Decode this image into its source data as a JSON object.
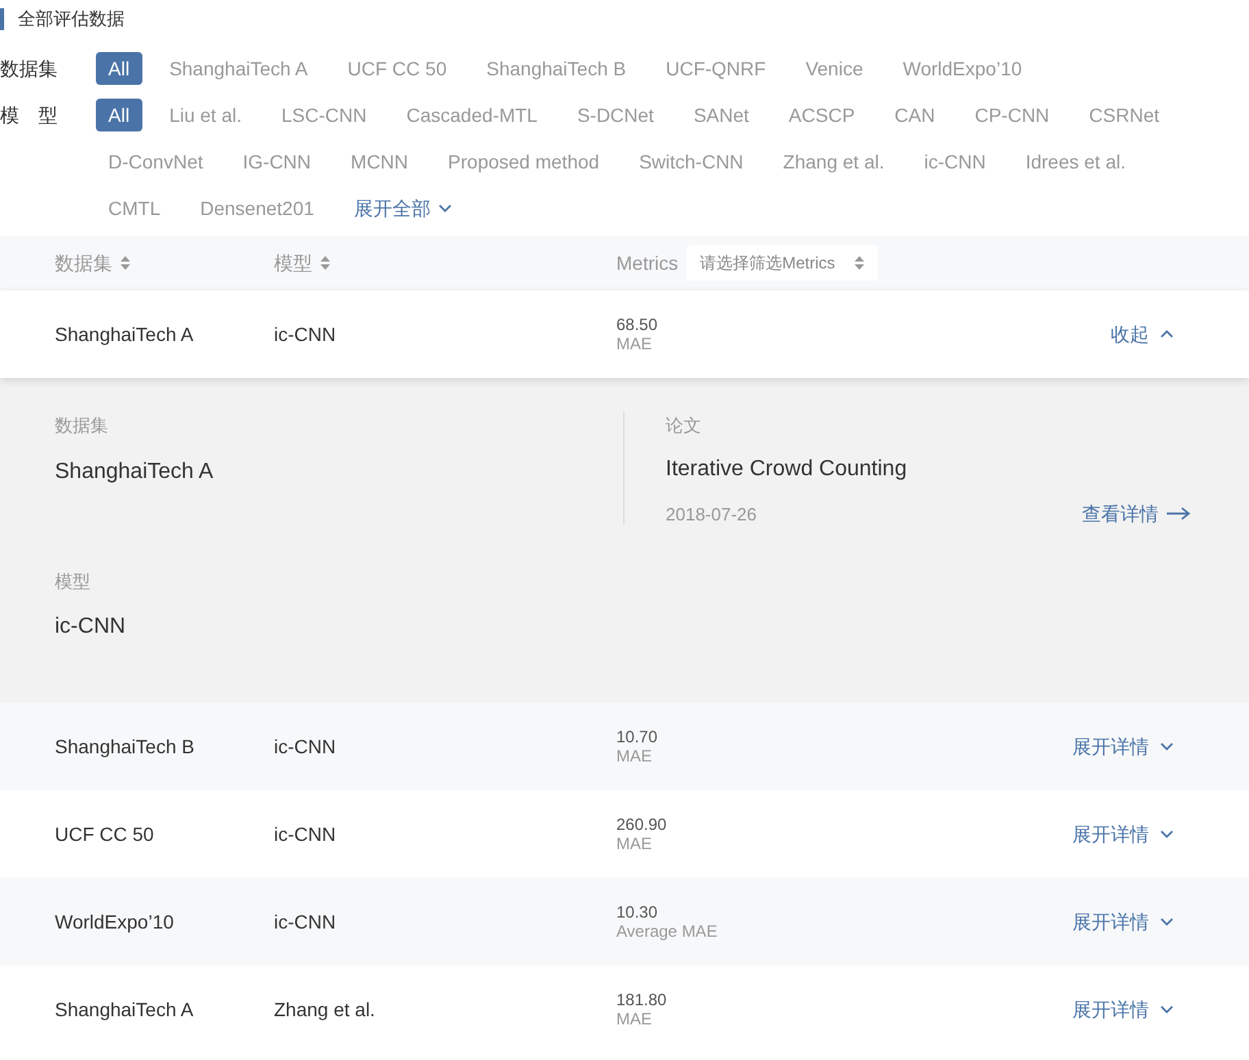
{
  "section_title": "全部评估数据",
  "filters": [
    {
      "label": "数据集",
      "options": [
        {
          "label": "All",
          "selected": true
        },
        {
          "label": "ShanghaiTech A",
          "selected": false
        },
        {
          "label": "UCF CC 50",
          "selected": false
        },
        {
          "label": "ShanghaiTech B",
          "selected": false
        },
        {
          "label": "UCF-QNRF",
          "selected": false
        },
        {
          "label": "Venice",
          "selected": false
        },
        {
          "label": "WorldExpo’10",
          "selected": false
        }
      ]
    },
    {
      "label": "模　型",
      "options": [
        {
          "label": "All",
          "selected": true
        },
        {
          "label": "Liu et al.",
          "selected": false
        },
        {
          "label": "LSC-CNN",
          "selected": false
        },
        {
          "label": "Cascaded-MTL",
          "selected": false
        },
        {
          "label": "S-DCNet",
          "selected": false
        },
        {
          "label": "SANet",
          "selected": false
        },
        {
          "label": "ACSCP",
          "selected": false
        },
        {
          "label": "CAN",
          "selected": false
        },
        {
          "label": "CP-CNN",
          "selected": false
        },
        {
          "label": "CSRNet",
          "selected": false
        },
        {
          "label": "D-ConvNet",
          "selected": false
        },
        {
          "label": "IG-CNN",
          "selected": false
        },
        {
          "label": "MCNN",
          "selected": false
        },
        {
          "label": "Proposed method",
          "selected": false
        },
        {
          "label": "Switch-CNN",
          "selected": false
        },
        {
          "label": "Zhang et al.",
          "selected": false
        },
        {
          "label": "ic-CNN",
          "selected": false
        },
        {
          "label": "Idrees et al.",
          "selected": false
        },
        {
          "label": "CMTL",
          "selected": false
        },
        {
          "label": "Densenet201",
          "selected": false
        }
      ],
      "more_link": "展开全部"
    }
  ],
  "table": {
    "columns": [
      {
        "label": "数据集",
        "kind": "sortable"
      },
      {
        "label": "模型",
        "kind": "sortable"
      },
      {
        "label": "Metrics",
        "kind": "select",
        "placeholder": "请选择筛选Metrics"
      }
    ],
    "rows": [
      {
        "dataset": "ShanghaiTech A",
        "model": "ic-CNN",
        "value": "68.50",
        "metric": "MAE",
        "toggle": "收起",
        "expanded": true,
        "detail": {
          "dataset_label": "数据集",
          "dataset": "ShanghaiTech A",
          "model_label": "模型",
          "model": "ic-CNN",
          "paper_label": "论文",
          "paper_title": "Iterative Crowd Counting",
          "date": "2018-07-26",
          "link": "查看详情"
        }
      },
      {
        "dataset": "ShanghaiTech B",
        "model": "ic-CNN",
        "value": "10.70",
        "metric": "MAE",
        "toggle": "展开详情",
        "expanded": false
      },
      {
        "dataset": "UCF CC 50",
        "model": "ic-CNN",
        "value": "260.90",
        "metric": "MAE",
        "toggle": "展开详情",
        "expanded": false
      },
      {
        "dataset": "WorldExpo’10",
        "model": "ic-CNN",
        "value": "10.30",
        "metric": "Average MAE",
        "toggle": "展开详情",
        "expanded": false
      },
      {
        "dataset": "ShanghaiTech A",
        "model": "Zhang et al.",
        "value": "181.80",
        "metric": "MAE",
        "toggle": "展开详情",
        "expanded": false
      }
    ]
  }
}
